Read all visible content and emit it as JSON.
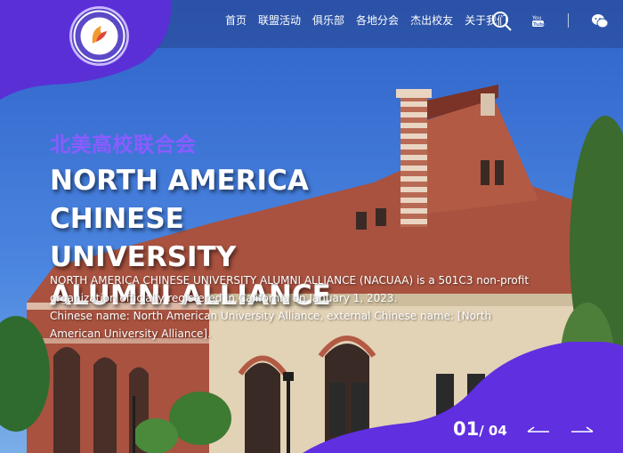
{
  "nav": {
    "items": [
      "首页",
      "联盟活动",
      "俱乐部",
      "各地分会",
      "杰出校友",
      "关于我们"
    ]
  },
  "icons": {
    "search": "search-icon",
    "youtube": "youtube-icon",
    "wechat": "wechat-icon",
    "prev": "arrow-left-icon",
    "next": "arrow-right-icon",
    "logo": "alliance-logo"
  },
  "logo_text": "北美高校联合会",
  "hero": {
    "title_cn": "北美高校联合会",
    "title_en_lines": [
      "NORTH AMERICA",
      "CHINESE UNIVERSITY",
      "ALUMNI ALLIANCE"
    ],
    "description": [
      "NORTH AMERICA CHINESE UNIVERSITY ALUMNI ALLIANCE (NACUAA) is a 501C3 non-profit organization officially registered in California on January 1, 2023.",
      "Chinese name: North American University Alliance, external Chinese name: [North American University Alliance]."
    ]
  },
  "slider": {
    "current": "01",
    "total": "/ 04"
  },
  "colors": {
    "accent_purple": "#6a35e6",
    "title_purple": "#8a5cff",
    "sky": "#3a6fd1",
    "brick": "#a8523f"
  }
}
